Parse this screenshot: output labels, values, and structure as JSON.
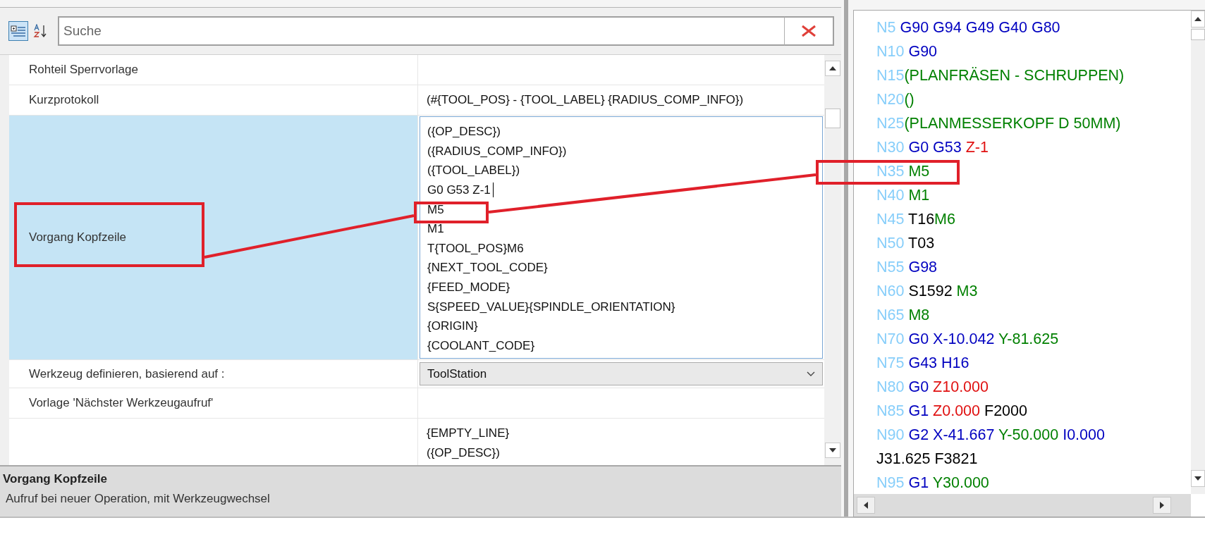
{
  "toolbar": {
    "view_buttons": [
      {
        "kind": "categorized",
        "selected": true
      },
      {
        "kind": "alphabetical",
        "selected": false
      }
    ],
    "search": {
      "placeholder": "Suche"
    }
  },
  "properties": [
    {
      "kind": "text",
      "name": "Rohteil Sperrvorlage",
      "selected": false
    },
    {
      "kind": "text",
      "name": "Kurzprotokoll",
      "value": "(#{TOOL_POS} - {TOOL_LABEL} {RADIUS_COMP_INFO})",
      "selected": false
    },
    {
      "kind": "multiline",
      "name": "Vorgang Kopfzeile",
      "selected": true,
      "lines": [
        {
          "text": "({OP_DESC})",
          "cursor": false
        },
        {
          "text": "({RADIUS_COMP_INFO})",
          "cursor": false
        },
        {
          "text": "({TOOL_LABEL})",
          "cursor": false
        },
        {
          "text": "G0 G53 Z-1",
          "cursor": true
        },
        {
          "text": "M5",
          "cursor": false
        },
        {
          "text": "M1",
          "cursor": false
        },
        {
          "text": "T{TOOL_POS}M6",
          "cursor": false
        },
        {
          "text": "{NEXT_TOOL_CODE}",
          "cursor": false
        },
        {
          "text": "{FEED_MODE}",
          "cursor": false
        },
        {
          "text": "S{SPEED_VALUE}{SPINDLE_ORIENTATION}",
          "cursor": false
        },
        {
          "text": "{ORIGIN}",
          "cursor": false
        },
        {
          "text": "{COOLANT_CODE}",
          "cursor": false
        }
      ]
    },
    {
      "kind": "dropdown",
      "name": "Werkzeug definieren, basierend auf :",
      "value": "ToolStation",
      "selected": false
    },
    {
      "kind": "text",
      "name": "Vorlage 'Nächster Werkzeugaufruf'",
      "selected": false
    },
    {
      "kind": "multiline",
      "selected": false,
      "lines": [
        {
          "text": "{EMPTY_LINE}",
          "cursor": false
        },
        {
          "text": "({OP_DESC})",
          "cursor": false
        }
      ]
    }
  ],
  "description": {
    "title": "Vorgang Kopfzeile",
    "text": "Aufruf bei neuer Operation, mit Werkzeugwechsel"
  },
  "nc_program": {
    "lines": [
      {
        "number": {
          "text": "N5",
          "color": "#87cefa"
        },
        "words": [
          {
            "text": " G90 G94 G49 G40 G80",
            "color": "#0000c0"
          }
        ]
      },
      {
        "number": {
          "text": "N10",
          "color": "#87cefa"
        },
        "words": [
          {
            "text": " G90",
            "color": "#0000c0"
          }
        ]
      },
      {
        "number": {
          "text": "N15",
          "color": "#87cefa"
        },
        "words": [
          {
            "text": "(PLANFRÄSEN - SCHRUPPEN)",
            "color": "#008000"
          }
        ]
      },
      {
        "number": {
          "text": "N20",
          "color": "#87cefa"
        },
        "words": [
          {
            "text": "()",
            "color": "#008000"
          }
        ]
      },
      {
        "number": {
          "text": "N25",
          "color": "#87cefa"
        },
        "words": [
          {
            "text": "(PLANMESSERKOPF D 50MM)",
            "color": "#008000"
          }
        ]
      },
      {
        "number": {
          "text": "N30",
          "color": "#87cefa"
        },
        "words": [
          {
            "text": " G0 G53",
            "color": "#0000c0"
          },
          {
            "text": " Z-1",
            "color": "#e01010"
          }
        ]
      },
      {
        "number": {
          "text": "N35",
          "color": "#87cefa"
        },
        "words": [
          {
            "text": " M5",
            "color": "#008000"
          }
        ]
      },
      {
        "number": {
          "text": "N40",
          "color": "#87cefa"
        },
        "words": [
          {
            "text": " M1",
            "color": "#008000"
          }
        ]
      },
      {
        "number": {
          "text": "N45",
          "color": "#87cefa"
        },
        "words": [
          {
            "text": " T16",
            "color": "#000000"
          },
          {
            "text": "M6",
            "color": "#008000"
          }
        ]
      },
      {
        "number": {
          "text": "N50",
          "color": "#87cefa"
        },
        "words": [
          {
            "text": " T03",
            "color": "#000000"
          }
        ]
      },
      {
        "number": {
          "text": "N55",
          "color": "#87cefa"
        },
        "words": [
          {
            "text": " G98",
            "color": "#0000c0"
          }
        ]
      },
      {
        "number": {
          "text": "N60",
          "color": "#87cefa"
        },
        "words": [
          {
            "text": " S1592",
            "color": "#000000"
          },
          {
            "text": " M3",
            "color": "#008000"
          }
        ]
      },
      {
        "number": {
          "text": "N65",
          "color": "#87cefa"
        },
        "words": [
          {
            "text": " M8",
            "color": "#008000"
          }
        ]
      },
      {
        "number": {
          "text": "N70",
          "color": "#87cefa"
        },
        "words": [
          {
            "text": " G0 X-10.042",
            "color": "#0000c0"
          },
          {
            "text": " Y-81.625",
            "color": "#008000"
          }
        ]
      },
      {
        "number": {
          "text": "N75",
          "color": "#87cefa"
        },
        "words": [
          {
            "text": " G43 H16",
            "color": "#0000c0"
          }
        ]
      },
      {
        "number": {
          "text": "N80",
          "color": "#87cefa"
        },
        "words": [
          {
            "text": " G0",
            "color": "#0000c0"
          },
          {
            "text": " Z10.000",
            "color": "#e01010"
          }
        ]
      },
      {
        "number": {
          "text": "N85",
          "color": "#87cefa"
        },
        "words": [
          {
            "text": " G1",
            "color": "#0000c0"
          },
          {
            "text": " Z0.000",
            "color": "#e01010"
          },
          {
            "text": " F2000",
            "color": "#000000"
          }
        ]
      },
      {
        "number": {
          "text": "N90",
          "color": "#87cefa"
        },
        "words": [
          {
            "text": " G2 X-41.667",
            "color": "#0000c0"
          },
          {
            "text": " Y-50.000",
            "color": "#008000"
          },
          {
            "text": " I0.000",
            "color": "#0000c0"
          }
        ]
      },
      {
        "words": [
          {
            "text": "J31.625 F3821",
            "color": "#000000"
          }
        ]
      },
      {
        "number": {
          "text": "N95",
          "color": "#87cefa"
        },
        "words": [
          {
            "text": " G1",
            "color": "#0000c0"
          },
          {
            "text": " Y30.000",
            "color": "#008000"
          }
        ]
      }
    ]
  }
}
